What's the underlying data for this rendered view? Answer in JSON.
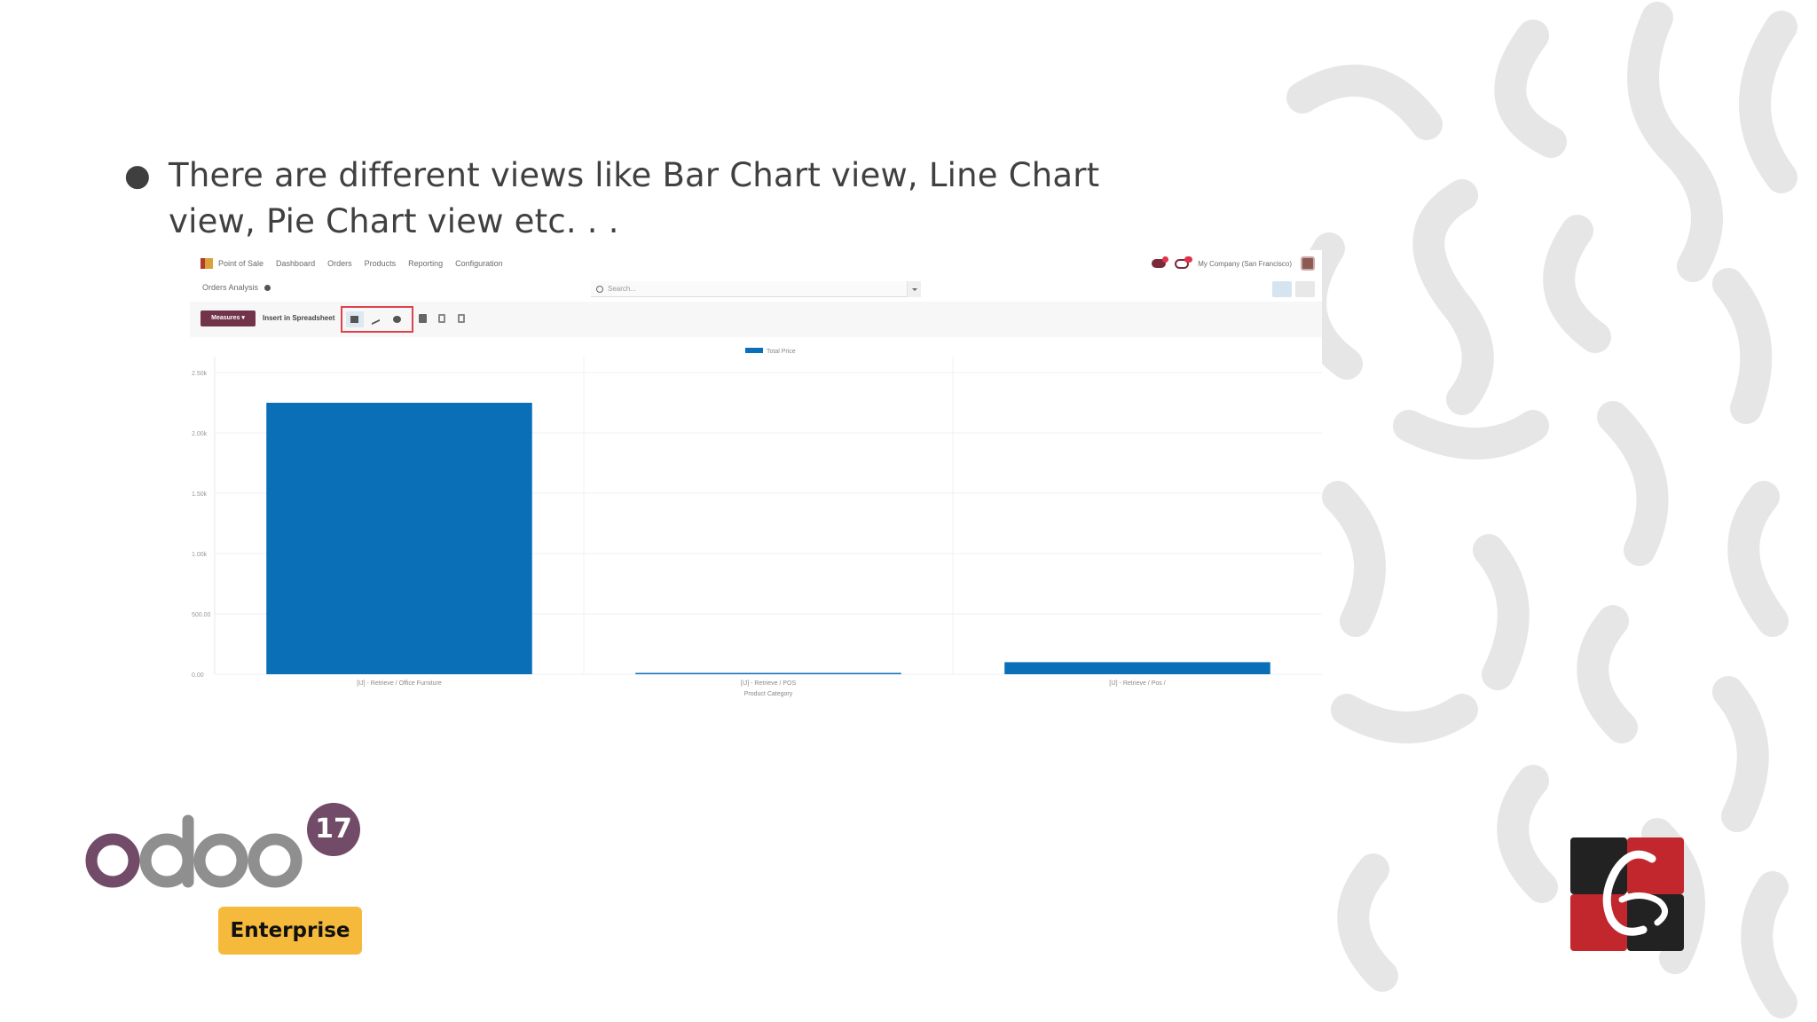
{
  "slide": {
    "bullet": "●",
    "text": "There are different views like Bar Chart view, Line Chart view, Pie Chart view etc. . ."
  },
  "odoo_app": {
    "navbar": {
      "app_name": "Point of Sale",
      "menu": [
        "Dashboard",
        "Orders",
        "Products",
        "Reporting",
        "Configuration"
      ],
      "company": "My Company (San Francisco)"
    },
    "breadcrumb": "Orders Analysis",
    "search": {
      "placeholder": "Search..."
    },
    "toolbar": {
      "measures_label": "Measures ▾",
      "insert_label": "Insert in Spreadsheet"
    },
    "chart_data": {
      "type": "bar",
      "legend": [
        "Total Price"
      ],
      "legend_position": "top-center",
      "series": [
        {
          "name": "Total Price",
          "color": "#0b6fb8",
          "values": [
            2250,
            4,
            100
          ]
        }
      ],
      "categories": [
        "[IJ] - Retrieve / Office Furniture",
        "[IJ] - Retrieve / POS",
        "[IJ] - Retrieve / Pos /"
      ],
      "xlabel": "Product Category",
      "yticks": [
        "0.00",
        "500.00",
        "1.00k",
        "1.50k",
        "2.00k",
        "2.50k"
      ],
      "ylim": [
        0,
        2500
      ],
      "grid": true
    }
  },
  "branding": {
    "odoo_wordmark": "odoo",
    "version": "17",
    "edition": "Enterprise",
    "colors": {
      "odoo_purple": "#714b67",
      "odoo_grey": "#8f8f8f",
      "enterprise_yellow": "#f5b93c",
      "cybrosys_red": "#c1272d",
      "cybrosys_black": "#222222"
    }
  }
}
